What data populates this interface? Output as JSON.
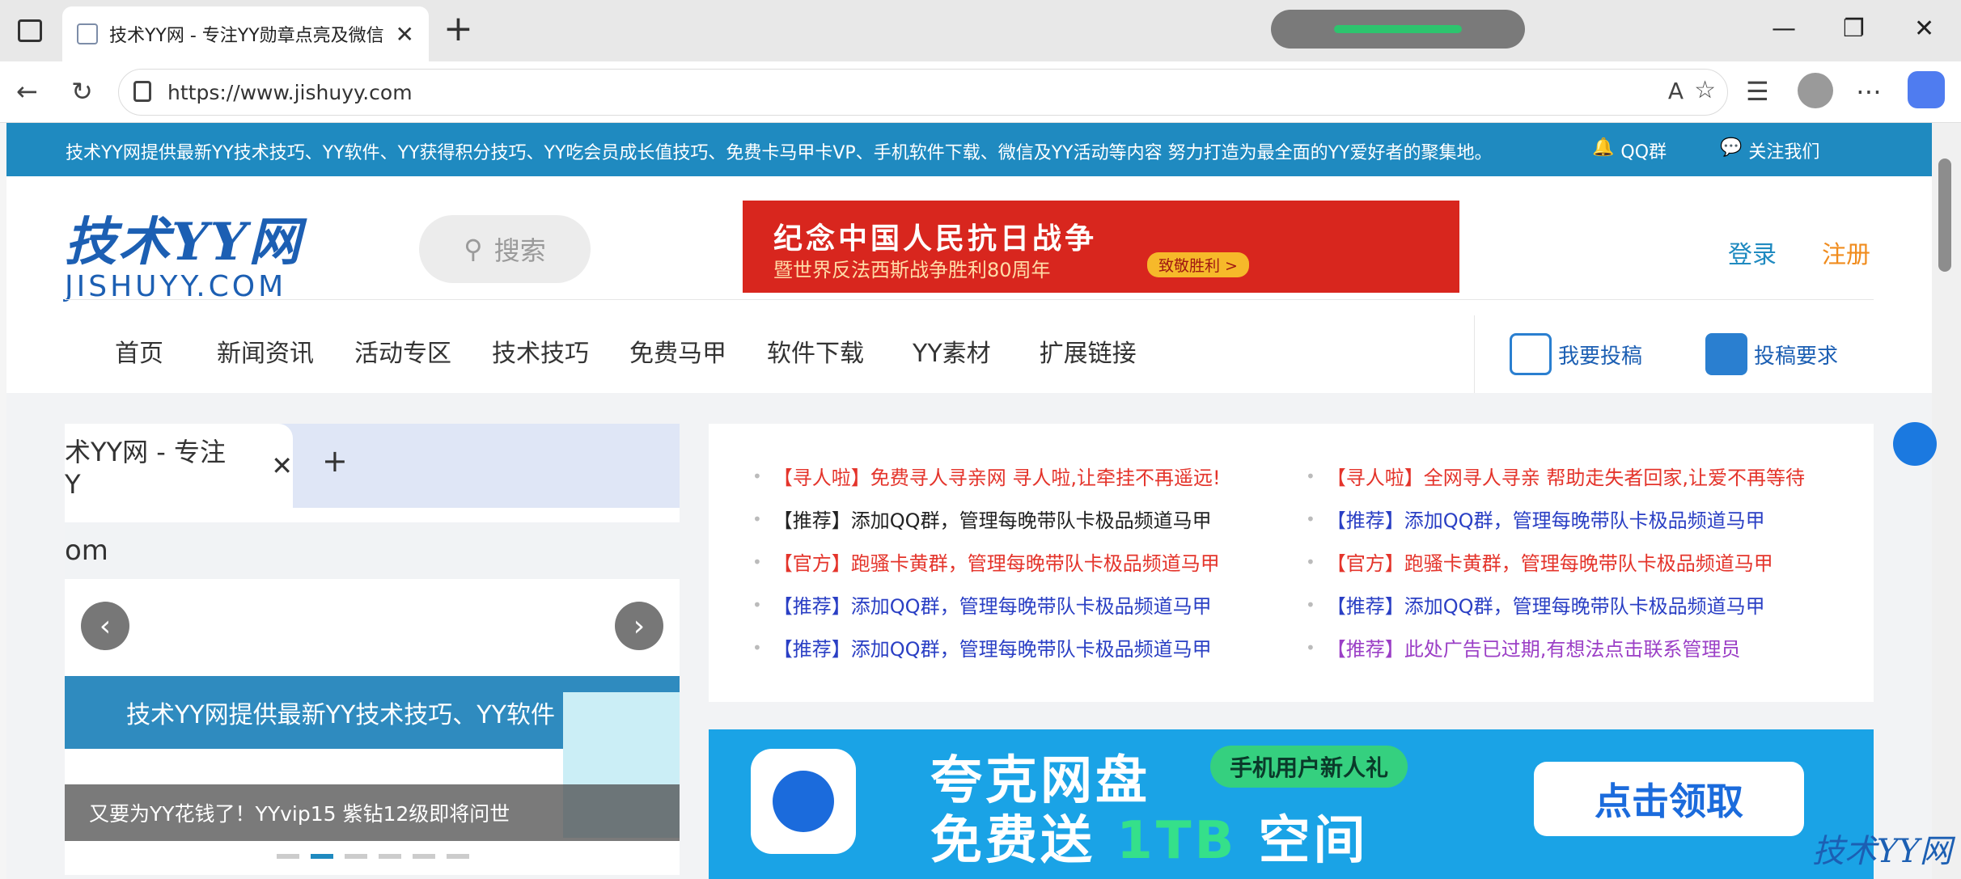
{
  "browser": {
    "tab_title": "技术YY网 - 专注YY勋章点亮及微信",
    "url": "https://www.jishuyy.com",
    "new_tab": "+",
    "close": "✕",
    "minimize": "—",
    "restore": "❐",
    "close_window": "✕"
  },
  "topbar": {
    "message": "技术YY网提供最新YY技术技巧、YY软件、YY获得积分技巧、YY吃会员成长值技巧、免费卡马甲卡VP、手机软件下载、微信及YY活动等内容 努力打造为最全面的YY爱好者的聚集地。",
    "qq": "QQ群",
    "follow": "关注我们"
  },
  "header": {
    "logo_cn": "技术YY网",
    "logo_en": "JISHUYY.COM",
    "search_label": "搜索",
    "banner_line1": "纪念中国人民抗日战争",
    "banner_line2": "暨世界反法西斯战争胜利80周年",
    "banner_tag": "致敬胜利 >",
    "login": "登录",
    "register": "注册"
  },
  "nav": [
    "首页",
    "新闻资讯",
    "活动专区",
    "技术技巧",
    "免费马甲",
    "软件下载",
    "YY素材",
    "扩展链接"
  ],
  "sub_actions": {
    "submit": "我要投稿",
    "requirements": "投稿要求"
  },
  "carousel": {
    "tab_text": "术YY网 - 专注Y",
    "tab_close": "✕",
    "tab_plus": "+",
    "url_fragment": "om",
    "strip_text": "技术YY网提供最新YY技术技巧、YY软件",
    "caption": "又要为YY花钱了！YYvip15 紫钻12级即将问世",
    "prev": "‹",
    "next": "›",
    "dots_total": 6,
    "dots_active": 2
  },
  "news": {
    "left": [
      {
        "text": "【寻人啦】免费寻人寻亲网 寻人啦,让牵挂不再遥远!",
        "color": "#e4342b"
      },
      {
        "text": "【推荐】添加QQ群，管理每晚带队卡极品频道马甲",
        "color": "#222222"
      },
      {
        "text": "【官方】跑骚卡黄群，管理每晚带队卡极品频道马甲",
        "color": "#e4342b"
      },
      {
        "text": "【推荐】添加QQ群，管理每晚带队卡极品频道马甲",
        "color": "#2a3fc4"
      },
      {
        "text": "【推荐】添加QQ群，管理每晚带队卡极品频道马甲",
        "color": "#2a3fc4"
      }
    ],
    "right": [
      {
        "text": "【寻人啦】全网寻人寻亲 帮助走失者回家,让爱不再等待",
        "color": "#e4342b"
      },
      {
        "text": "【推荐】添加QQ群，管理每晚带队卡极品频道马甲",
        "color": "#2a3fc4"
      },
      {
        "text": "【官方】跑骚卡黄群，管理每晚带队卡极品频道马甲",
        "color": "#e4342b"
      },
      {
        "text": "【推荐】添加QQ群，管理每晚带队卡极品频道马甲",
        "color": "#2a3fc4"
      },
      {
        "text": "【推荐】此处广告已过期,有想法点击联系管理员",
        "color": "#9b3fc6"
      }
    ]
  },
  "ad": {
    "title": "夸克网盘",
    "tag": "手机用户新人礼",
    "line2_pre": "免费送 ",
    "line2_hi": "1TB",
    "line2_post": " 空间",
    "button": "点击领取"
  },
  "watermark": "技术YY网"
}
